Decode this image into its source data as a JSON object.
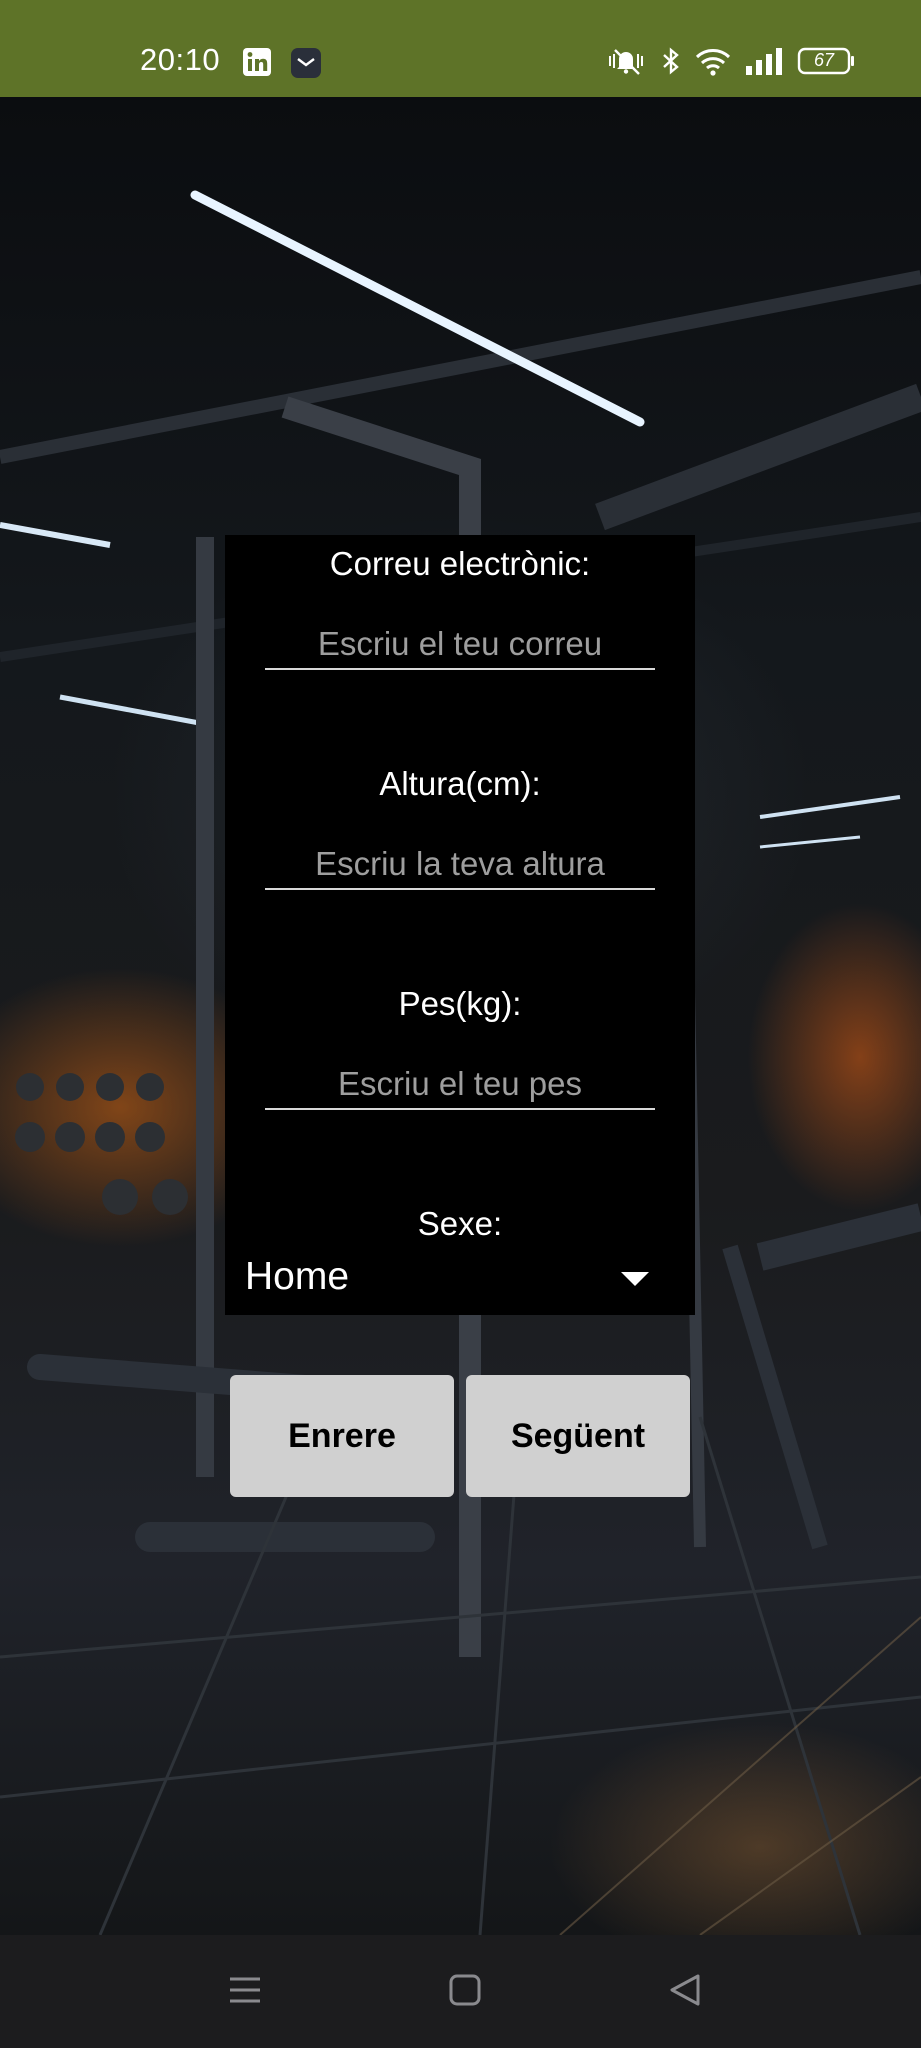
{
  "status_bar": {
    "time": "20:10",
    "battery": "67",
    "left_icons": [
      "linkedin-icon",
      "mail-app-icon"
    ],
    "right_icons": [
      "vibrate-icon",
      "bluetooth-icon",
      "wifi-icon",
      "signal-icon",
      "battery-icon"
    ]
  },
  "form": {
    "email": {
      "label": "Correu electrònic:",
      "placeholder": "Escriu el teu correu",
      "value": ""
    },
    "height": {
      "label": "Altura(cm):",
      "placeholder": "Escriu la teva altura",
      "value": ""
    },
    "weight": {
      "label": "Pes(kg):",
      "placeholder": "Escriu el teu pes",
      "value": ""
    },
    "sex": {
      "label": "Sexe:",
      "selected": "Home"
    }
  },
  "buttons": {
    "back": "Enrere",
    "next": "Següent"
  },
  "nav_bar": {
    "icons": [
      "menu-icon",
      "home-square-icon",
      "back-triangle-icon"
    ]
  },
  "colors": {
    "status_bar": "#5e7328",
    "panel": "#000000",
    "button": "#d0d0d0",
    "nav_bar": "#1c1c1e"
  }
}
